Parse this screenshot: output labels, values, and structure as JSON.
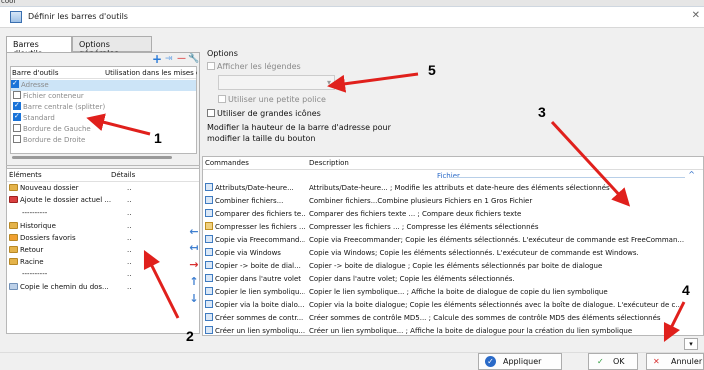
{
  "top_strip_text": "cool",
  "window": {
    "title": "Définir les barres d'outils",
    "close_glyph": "✕"
  },
  "tabs": [
    {
      "label": "Barres d'outils",
      "active": true
    },
    {
      "label": "Options générales",
      "active": false
    }
  ],
  "toolbar_list": {
    "col_name": "Barre d'outils",
    "col_usage": "Utilisation dans les mises en",
    "items": [
      {
        "label": "Adresse",
        "checked": true,
        "selected": true
      },
      {
        "label": "Fichier conteneur",
        "checked": false
      },
      {
        "label": "Barre centrale (splitter)",
        "checked": true
      },
      {
        "label": "Standard",
        "checked": true
      },
      {
        "label": "Bordure de Gauche",
        "checked": false
      },
      {
        "label": "Bordure de Droite",
        "checked": false
      }
    ],
    "buttons": {
      "add": "+",
      "separator": "⇥",
      "remove": "—",
      "configure": "🔧"
    }
  },
  "elements_list": {
    "col_elements": "Éléments",
    "col_details": "Détails",
    "items": [
      {
        "label": "Nouveau dossier",
        "detail": "..",
        "icon": "folder-icon"
      },
      {
        "label": "Ajoute le dossier actuel ...",
        "detail": "..",
        "icon": "heart-folder-icon"
      },
      {
        "label": "----------",
        "detail": "..",
        "icon": ""
      },
      {
        "label": "Historique",
        "detail": "..",
        "icon": "history-icon"
      },
      {
        "label": "Dossiers favoris",
        "detail": "..",
        "icon": "favorites-icon"
      },
      {
        "label": "Retour",
        "detail": "..",
        "icon": "back-icon"
      },
      {
        "label": "Racine",
        "detail": "..",
        "icon": "root-icon"
      },
      {
        "label": "----------",
        "detail": "..",
        "icon": ""
      },
      {
        "label": "Copie le chemin du dos...",
        "detail": "..",
        "icon": "copy-path-icon"
      }
    ]
  },
  "options": {
    "heading": "Options",
    "show_legends": "Afficher les légendes",
    "small_font": "Utiliser une petite police",
    "large_icons": "Utiliser de grandes icônes",
    "address_note": "Modifier la hauteur de la barre d'adresse pour modifier la taille du bouton"
  },
  "commands": {
    "col_commands": "Commandes",
    "col_description": "Description",
    "group": "Fichier",
    "rows": [
      {
        "cmd": "Attributs/Date-heure...",
        "desc": "Attributs/Date-heure... ; Modifie les attributs et date-heure des éléments sélectionnés"
      },
      {
        "cmd": "Combiner fichiers...",
        "desc": "Combiner fichiers...Combine plusieurs Fichiers en 1 Gros Fichier"
      },
      {
        "cmd": "Comparer des fichiers te...",
        "desc": "Comparer des fichiers texte ... ; Compare deux fichiers texte"
      },
      {
        "cmd": "Compresser les fichiers ...",
        "desc": "Compresser les fichiers ... ; Compresse les éléments sélectionnés"
      },
      {
        "cmd": "Copie via Freecommand...",
        "desc": "Copie via Freecommander; Copie les éléments sélectionnés. L'exécuteur de commande est FreeComman..."
      },
      {
        "cmd": "Copie via Windows",
        "desc": "Copie via Windows; Copie les éléments sélectionnés. L'exécuteur de commande est Windows."
      },
      {
        "cmd": "Copier -> boite de dial...",
        "desc": "Copier -> boite de dialogue ; Copie les éléments sélectionnés par boite de dialogue"
      },
      {
        "cmd": "Copier dans l'autre volet",
        "desc": "Copier dans l'autre volet; Copie les éléments sélectionnés."
      },
      {
        "cmd": "Copier le lien symboliqu...",
        "desc": "Copier le lien symbolique... ; Affiche la boite de dialogue de copie du lien symbolique"
      },
      {
        "cmd": "Copier via la boite dialo...",
        "desc": "Copier via la boite dialogue; Copie les éléments sélectionnés avec la boîte de dialogue. L'exécuteur de c..."
      },
      {
        "cmd": "Créer sommes de contr...",
        "desc": "Créer sommes de contrôle MD5... ; Calcule des sommes de contrôle MD5 des éléments sélectionnés"
      },
      {
        "cmd": "Créer un lien symboliqu...",
        "desc": "Créer un lien symbolique... ; Affiche la boite de dialogue pour la création du lien symbolique"
      }
    ]
  },
  "move_buttons": [
    "←",
    "↤",
    "→",
    "↑",
    "↓"
  ],
  "bottom": {
    "apply": "Appliquer",
    "ok": "OK",
    "cancel": "Annuler",
    "dropdown_glyph": "▾"
  },
  "annotations": [
    "1",
    "2",
    "3",
    "4",
    "5"
  ],
  "colors": {
    "accent": "#1a73d8",
    "annotation_arrow": "#e0201c",
    "group_header": "#2a6ac8"
  }
}
